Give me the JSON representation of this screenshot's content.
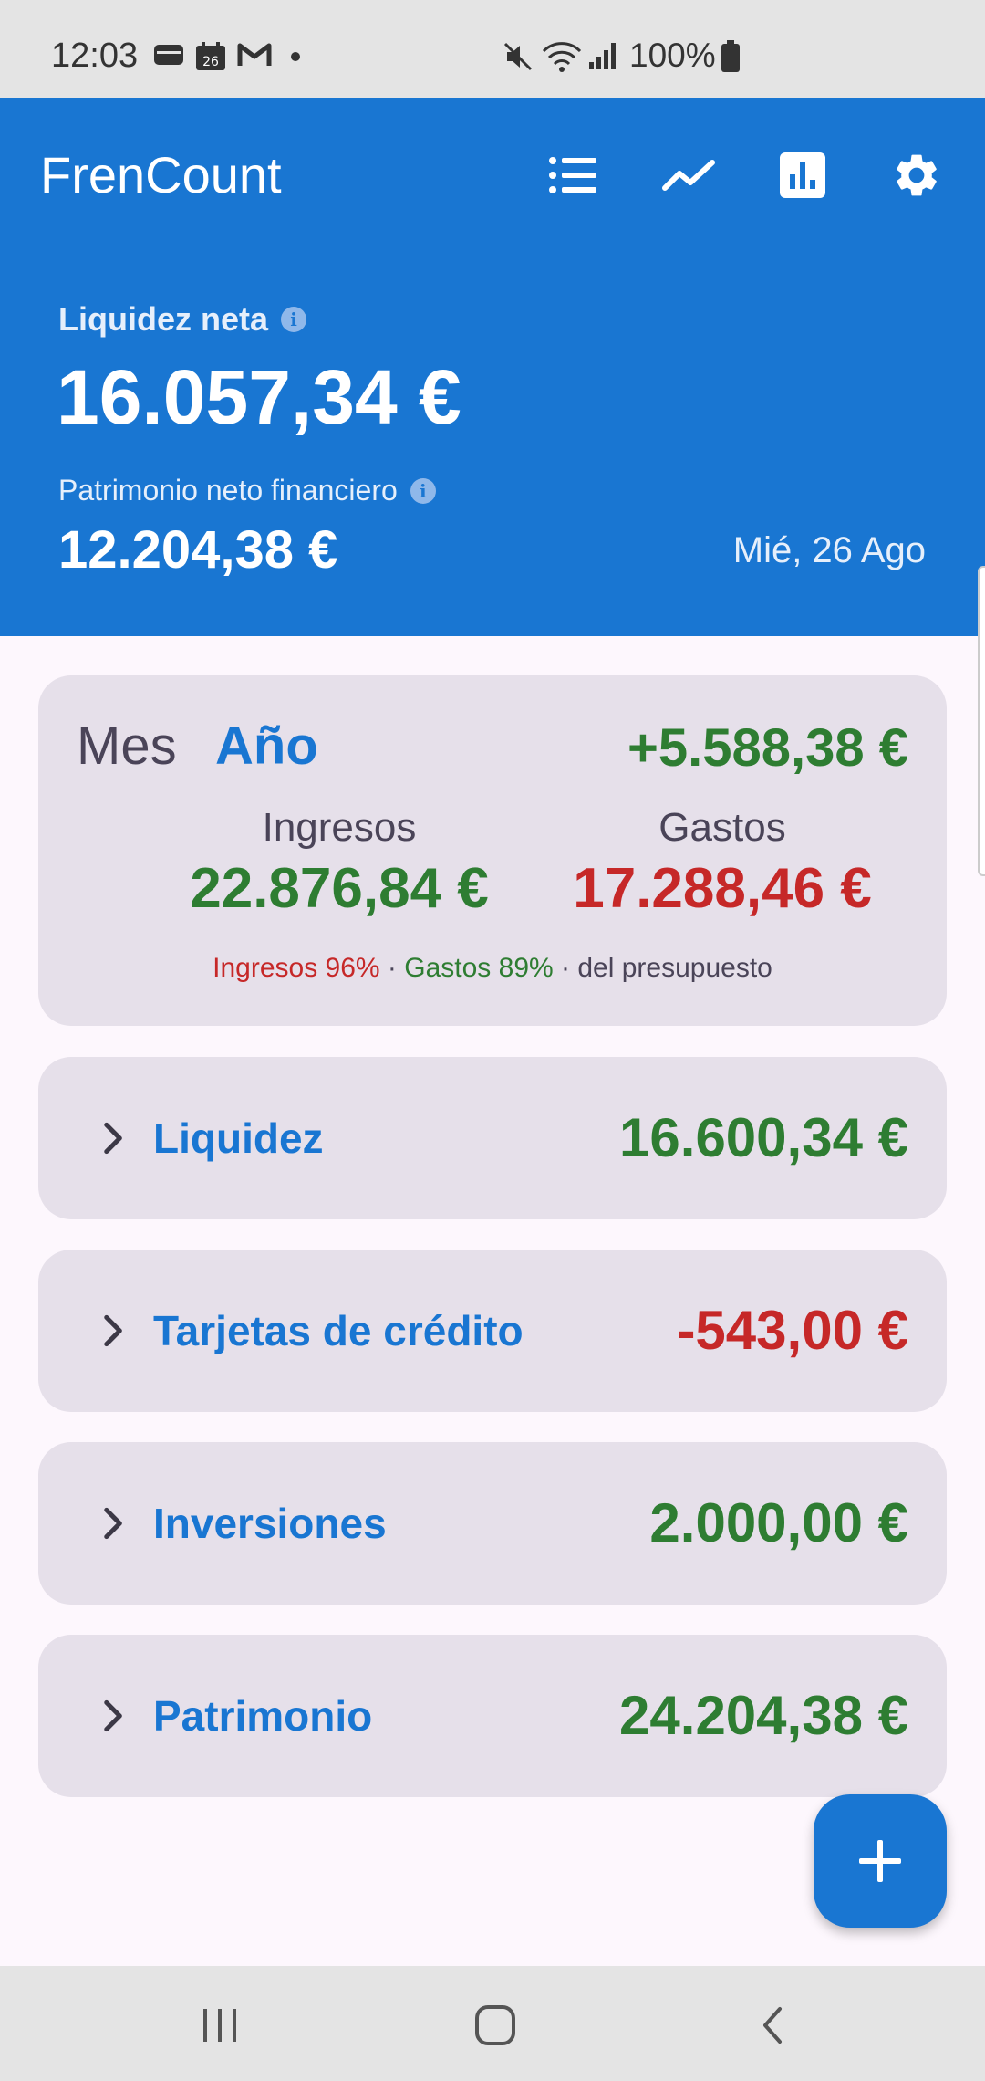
{
  "status_bar": {
    "time": "12:03",
    "calendar_day": "26",
    "battery": "100%"
  },
  "app": {
    "title": "FrenCount",
    "accent_color": "#1976d2"
  },
  "header": {
    "net_liquidity_label": "Liquidez neta",
    "net_liquidity_value": "16.057,34 €",
    "net_worth_label": "Patrimonio neto financiero",
    "net_worth_value": "12.204,38 €",
    "date": "Mié, 26 Ago"
  },
  "summary": {
    "tab_month": "Mes",
    "tab_year": "Año",
    "selected_tab": "Año",
    "total": "+5.588,38 €",
    "income_label": "Ingresos",
    "income_value": "22.876,84 €",
    "expenses_label": "Gastos",
    "expenses_value": "17.288,46 €",
    "budget_income": "Ingresos 96%",
    "separator": "·",
    "budget_expenses": "Gastos 89%",
    "budget_suffix": "del presupuesto"
  },
  "accounts": [
    {
      "name": "Liquidez",
      "amount": "16.600,34 €",
      "sign": "positive"
    },
    {
      "name": "Tarjetas de crédito",
      "amount": "-543,00 €",
      "sign": "negative"
    },
    {
      "name": "Inversiones",
      "amount": "2.000,00 €",
      "sign": "positive"
    },
    {
      "name": "Patrimonio",
      "amount": "24.204,38 €",
      "sign": "positive"
    }
  ],
  "colors": {
    "positive": "#2e7d32",
    "negative": "#c62828",
    "header_bg": "#1976d2",
    "card_bg": "#e6e0ea"
  },
  "icons": {
    "toolbar": [
      "list-icon",
      "trending-icon",
      "bar-chart-icon",
      "settings-icon"
    ],
    "fab": "add-icon",
    "nav": [
      "recents-icon",
      "home-icon",
      "back-icon"
    ]
  }
}
